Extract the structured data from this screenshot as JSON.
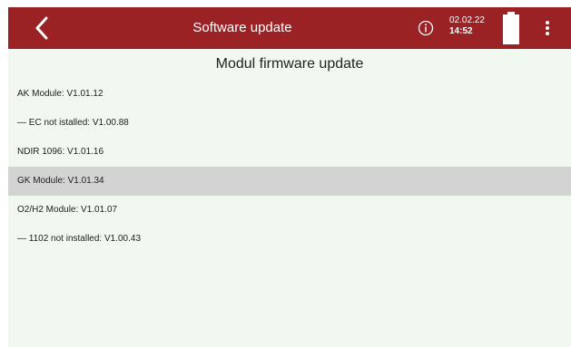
{
  "header": {
    "back_icon": "chevron-left-icon",
    "title": "Software update",
    "info_icon": "info-circle-icon",
    "date": "02.02.22",
    "time": "14:52",
    "battery_icon": "battery-full-icon",
    "menu_icon": "more-vertical-icon",
    "bar_color": "#9a2225"
  },
  "main": {
    "title": "Modul firmware update",
    "selected_index": 3,
    "selected_color": "#d3d3d3",
    "modules": [
      {
        "label": "AK Module: V1.01.12"
      },
      {
        "label": "— EC not istalled: V1.00.88"
      },
      {
        "label": "NDIR 1096: V1.01.16"
      },
      {
        "label": "GK Module: V1.01.34"
      },
      {
        "label": "O2/H2 Module: V1.01.07"
      },
      {
        "label": "— 1102 not installed: V1.00.43"
      }
    ]
  }
}
